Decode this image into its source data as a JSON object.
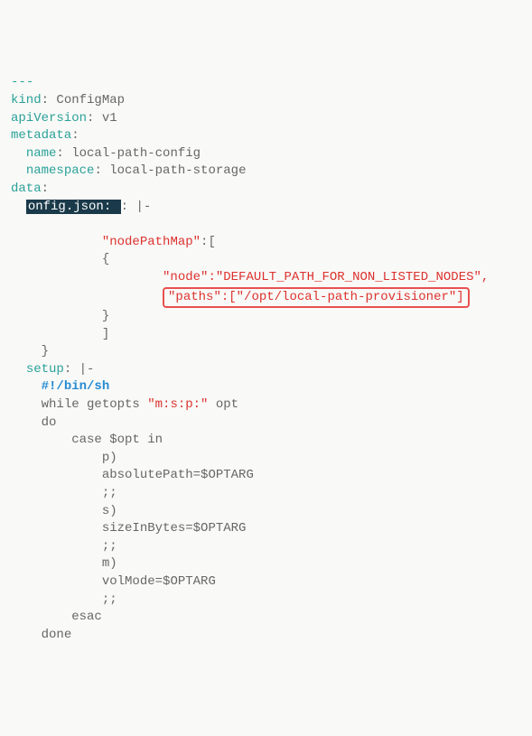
{
  "code": {
    "dashes": "---",
    "kind_key": "kind",
    "kind_val": ": ConfigMap",
    "apiVersion_key": "apiVersion",
    "apiVersion_val": ": v1",
    "metadata_key": "metadata",
    "metadata_colon": ":",
    "name_key": "name",
    "name_val": ": local-path-config",
    "namespace_key": "namespace",
    "namespace_val": ": local-path-storage",
    "data_key": "data",
    "data_colon": ":",
    "config_json_key": "onfig.json",
    "config_json_prefix": ": ",
    "config_json_pipe": ": |-",
    "nodePathMap": "\"nodePathMap\"",
    "nodePathMap_after": ":[",
    "brace_open": "{",
    "node_key": "\"node\"",
    "node_val": ":\"DEFAULT_PATH_FOR_NON_LISTED_NODES\",",
    "paths_line": "\"paths\":[\"/opt/local-path-provisioner\"]",
    "brace_close": "}",
    "bracket_close": "]",
    "outer_brace_close": "}",
    "setup_key": "setup",
    "setup_pipe": ": |-",
    "shebang": "#!/bin/sh",
    "while_pre": "while getopts ",
    "getopts_arg": "\"m:s:p:\"",
    "while_post": " opt",
    "do": "do",
    "case": "case $opt in",
    "p_case": "p)",
    "absolutePath": "absolutePath=$OPTARG",
    "semicolons1": ";;",
    "s_case": "s)",
    "sizeInBytes": "sizeInBytes=$OPTARG",
    "semicolons2": ";;",
    "m_case": "m)",
    "volMode": "volMode=$OPTARG",
    "semicolons3": ";;",
    "esac": "esac",
    "done": "done"
  }
}
